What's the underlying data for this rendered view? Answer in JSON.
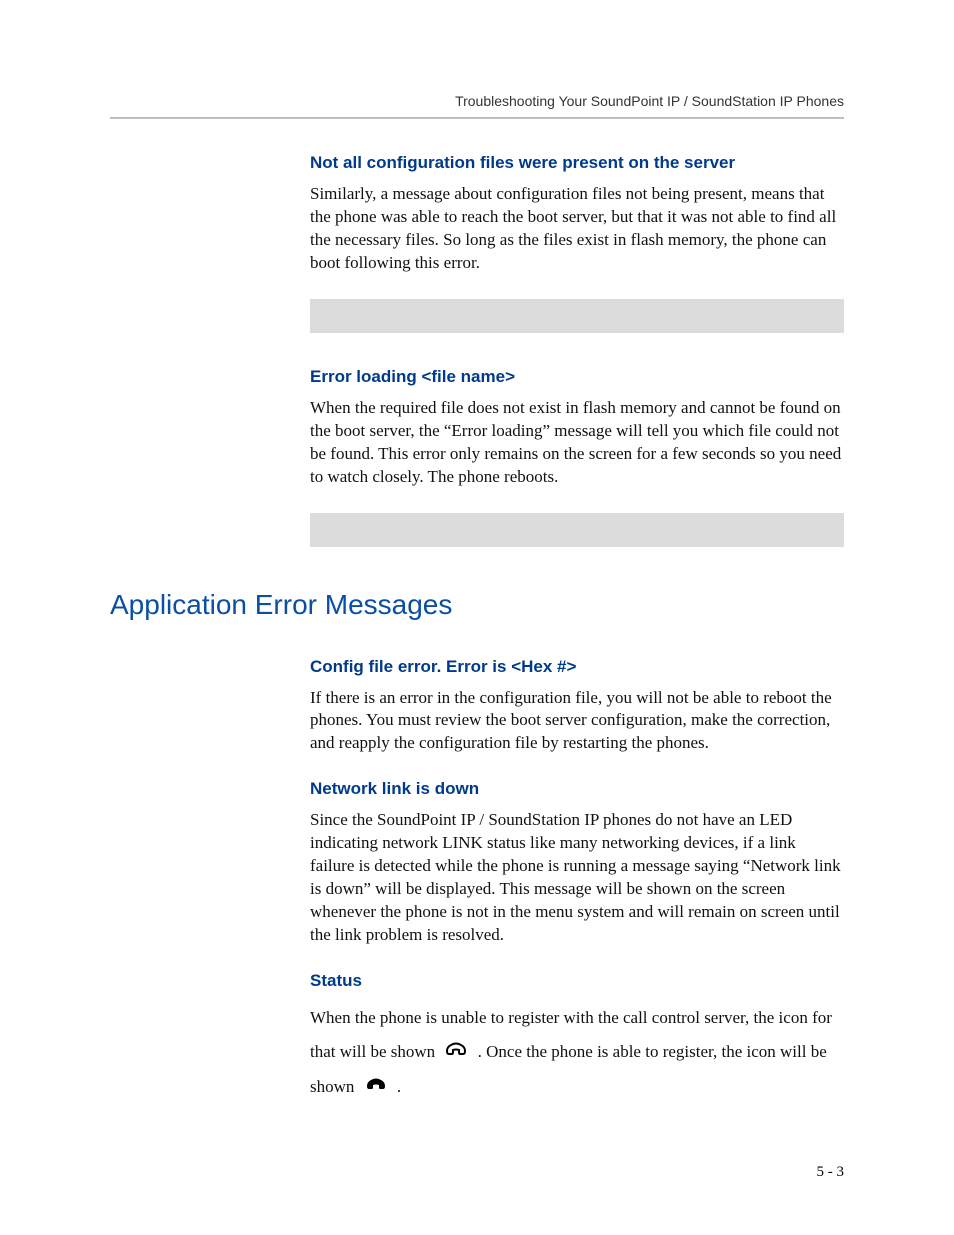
{
  "header": {
    "running_title": "Troubleshooting Your SoundPoint IP / SoundStation IP Phones"
  },
  "sections": {
    "s1": {
      "heading": "Not all configuration files were present on the server",
      "body": "Similarly, a message about configuration files not being present, means that the phone was able to reach the boot server, but that it was not able to find all the necessary files. So long as the files exist in flash memory, the phone can boot following this error."
    },
    "s2": {
      "heading": "Error loading <file name>",
      "body": "When the required file does not exist in flash memory and cannot be found on the boot server, the “Error loading” message will tell you which file could not be found. This error only remains on the screen for a few seconds so you need to watch closely. The phone reboots."
    },
    "main_heading": "Application Error Messages",
    "s3": {
      "heading": "Config file error. Error is <Hex #>",
      "body": "If there is an error in the configuration file, you will not be able to reboot the phones. You must review the boot server configuration, make the correction, and reapply the configuration file by restarting the phones."
    },
    "s4": {
      "heading": "Network link is down",
      "body": "Since the SoundPoint IP / SoundStation IP phones do not have an LED indicating network LINK status like many networking devices, if a link failure is detected while the phone is running a message saying “Network link is down” will be displayed. This message will be shown on the screen whenever the phone is not in the menu system and will remain on screen until the link problem is resolved."
    },
    "s5": {
      "heading": " Status",
      "body_part1": "When the phone is unable to register with the call control server, the icon for that  will be shown",
      "body_part2": ". Once the phone is able to register, the icon will be shown",
      "body_part3": "."
    }
  },
  "footer": {
    "page_number": "5 - 3"
  }
}
